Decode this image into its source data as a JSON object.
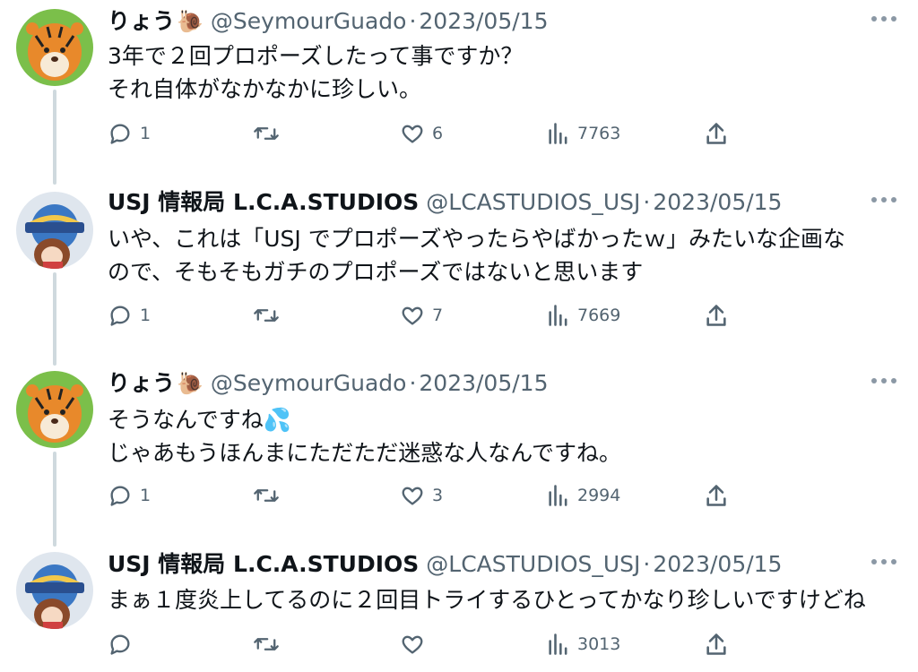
{
  "tweets": [
    {
      "name": "りょう",
      "badge": "🐌",
      "handle": "@SeymourGuado",
      "dot": "·",
      "date": "2023/05/15",
      "avatar": "tiger-avatar",
      "lines": [
        "3年で２回プロポーズしたって事ですか？",
        "それ自体がなかなかに珍しい。"
      ],
      "replies": "1",
      "retweets": "",
      "likes": "6",
      "views": "7763"
    },
    {
      "name": "USJ 情報局 L.C.A.STUDIOS",
      "badge": "",
      "handle": "@LCASTUDIOS_USJ",
      "dot": "·",
      "date": "2023/05/15",
      "avatar": "usj-avatar",
      "lines": [
        "いや、これは「USJ でプロポーズやったらやばかったｗ」みたいな企画な",
        "ので、そもそもガチのプロポーズではないと思います"
      ],
      "replies": "1",
      "retweets": "",
      "likes": "7",
      "views": "7669"
    },
    {
      "name": "りょう",
      "badge": "🐌",
      "handle": "@SeymourGuado",
      "dot": "·",
      "date": "2023/05/15",
      "avatar": "tiger-avatar",
      "lines": [
        "そうなんですね💦",
        "じゃあもうほんまにただただ迷惑な人なんですね。"
      ],
      "replies": "1",
      "retweets": "",
      "likes": "3",
      "views": "2994"
    },
    {
      "name": "USJ 情報局 L.C.A.STUDIOS",
      "badge": "",
      "handle": "@LCASTUDIOS_USJ",
      "dot": "·",
      "date": "2023/05/15",
      "avatar": "usj-avatar",
      "lines": [
        "まぁ１度炎上してるのに２回目トライするひとってかなり珍しいですけどね"
      ],
      "replies": "",
      "retweets": "",
      "likes": "",
      "views": "3013"
    }
  ],
  "colors": {
    "text": "#0f1419",
    "secondary": "#536471",
    "thread": "#cfd9de"
  }
}
